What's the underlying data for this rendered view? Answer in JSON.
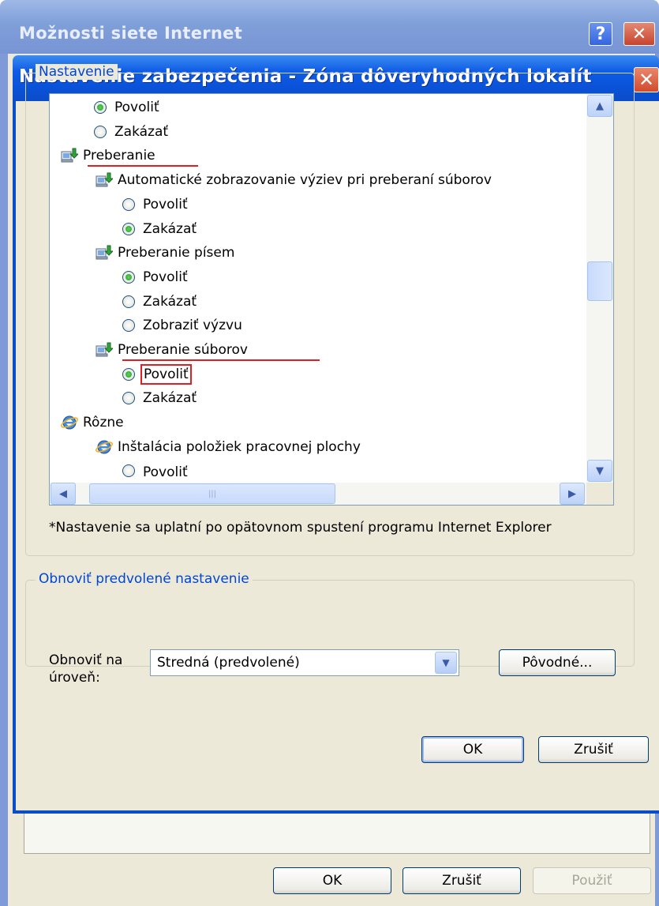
{
  "outer_window": {
    "title": "Možnosti siete Internet",
    "help_glyph": "?",
    "close_glyph": "✕",
    "buttons": {
      "ok": "OK",
      "cancel": "Zrušiť",
      "apply": "Použiť"
    }
  },
  "dialog": {
    "title": "Nastavenie zabezpečenia - Zóna dôveryhodných lokalít",
    "close_glyph": "✕",
    "settings_group_label": "Nastavenie",
    "tree": [
      {
        "type": "radio",
        "label": "Povoliť",
        "checked": true,
        "indent": 1
      },
      {
        "type": "radio",
        "label": "Zakázať",
        "checked": false,
        "indent": 1
      },
      {
        "type": "category",
        "label": "Preberanie",
        "icon": "download-settings-icon",
        "indent": 0,
        "underlined": true
      },
      {
        "type": "setting",
        "label": "Automatické zobrazovanie výziev pri preberaní súborov",
        "icon": "download-settings-icon",
        "indent": 1
      },
      {
        "type": "radio",
        "label": "Povoliť",
        "checked": false,
        "indent": 2
      },
      {
        "type": "radio",
        "label": "Zakázať",
        "checked": true,
        "indent": 2
      },
      {
        "type": "setting",
        "label": "Preberanie písem",
        "icon": "download-settings-icon",
        "indent": 1
      },
      {
        "type": "radio",
        "label": "Povoliť",
        "checked": true,
        "indent": 2
      },
      {
        "type": "radio",
        "label": "Zakázať",
        "checked": false,
        "indent": 2
      },
      {
        "type": "radio",
        "label": "Zobraziť výzvu",
        "checked": false,
        "indent": 2
      },
      {
        "type": "setting",
        "label": "Preberanie súborov",
        "icon": "download-settings-icon",
        "indent": 1,
        "underlined": true
      },
      {
        "type": "radio",
        "label": "Povoliť",
        "checked": true,
        "indent": 2,
        "highlighted": true
      },
      {
        "type": "radio",
        "label": "Zakázať",
        "checked": false,
        "indent": 2
      },
      {
        "type": "category",
        "label": "Rôzne",
        "icon": "internet-explorer-icon",
        "indent": 0
      },
      {
        "type": "setting",
        "label": "Inštalácia položiek pracovnej plochy",
        "icon": "internet-explorer-icon",
        "indent": 1
      },
      {
        "type": "radio",
        "label": "Povoliť",
        "checked": false,
        "indent": 2,
        "clipped": true
      }
    ],
    "restart_note": "*Nastavenie sa uplatní po opätovnom spustení programu Internet Explorer",
    "reset_group_label": "Obnoviť predvolené nastavenie",
    "reset_label_line1": "Obnoviť na",
    "reset_label_line2": "úroveň:",
    "reset_level_value": "Stredná (predvolené)",
    "reset_button": "Pôvodné...",
    "ok_button": "OK",
    "cancel_button": "Zrušiť"
  },
  "colors": {
    "highlight_red": "#e02020",
    "dialog_titlebar": "#0b52d8",
    "dialog_body": "#ece9d8"
  }
}
